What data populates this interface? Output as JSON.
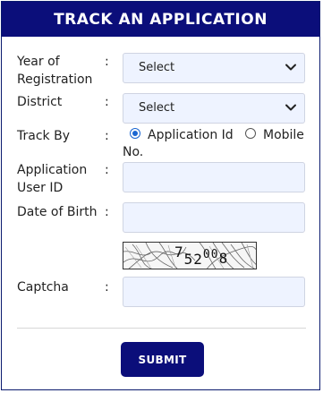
{
  "form": {
    "title": "TRACK AN APPLICATION",
    "year": {
      "label_line1": "Year of",
      "label_line2": "Registration",
      "value": "Select"
    },
    "district": {
      "label": "District",
      "value": "Select"
    },
    "track_by": {
      "label": "Track By",
      "option1": "Application Id",
      "option2_line1": "Mobile",
      "option2_line2": "No.",
      "selected": "Application Id"
    },
    "app_user_id": {
      "label_line1": "Application",
      "label_line2": "User ID",
      "value": ""
    },
    "dob": {
      "label": "Date of Birth",
      "value": ""
    },
    "captcha": {
      "label": "Captcha",
      "image_text": "752008",
      "value": ""
    },
    "colon": ":",
    "submit_label": "SUBMIT"
  }
}
